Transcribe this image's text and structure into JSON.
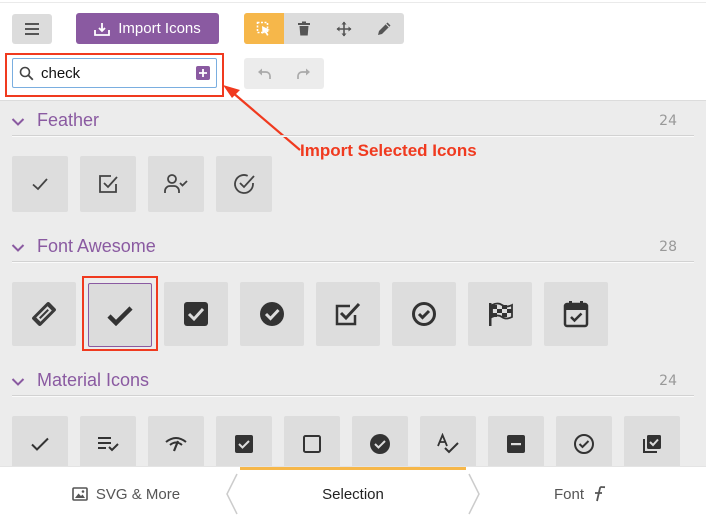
{
  "toolbar": {
    "import_label": "Import Icons",
    "tools": [
      "select-icon",
      "trash-icon",
      "move-icon",
      "pencil-icon"
    ],
    "undo_icons": [
      "undo-icon",
      "redo-icon"
    ]
  },
  "search": {
    "value": "check"
  },
  "annotation": "Import Selected Icons",
  "sections": [
    {
      "title": "Feather",
      "count": "24",
      "icons": [
        "check-icon",
        "check-square-icon",
        "user-check-icon",
        "check-circle-icon"
      ]
    },
    {
      "title": "Font Awesome",
      "count": "28",
      "icons": [
        "money-check-icon",
        "check-icon",
        "check-square-icon",
        "check-circle-icon",
        "check-square-outline-icon",
        "check-circle-outline-icon",
        "flag-checkered-icon",
        "calendar-check-icon"
      ]
    },
    {
      "title": "Material Icons",
      "count": "24",
      "icons": [
        "check-icon",
        "playlist-check-icon",
        "network-check-icon",
        "check-box-icon",
        "check-box-outline-blank-icon",
        "check-circle-icon",
        "spellcheck-icon",
        "indeterminate-check-box-icon",
        "check-circle-outline-icon",
        "library-add-check-icon"
      ]
    }
  ],
  "footer": {
    "tabs": [
      {
        "label": "SVG & More",
        "icon": "image-icon"
      },
      {
        "label": "Selection"
      },
      {
        "label": "Font",
        "icon": "font-f-icon"
      }
    ]
  },
  "colors": {
    "accent": "#8a5aa1",
    "highlight": "#f03a1f",
    "active_tool": "#f6b74a"
  }
}
